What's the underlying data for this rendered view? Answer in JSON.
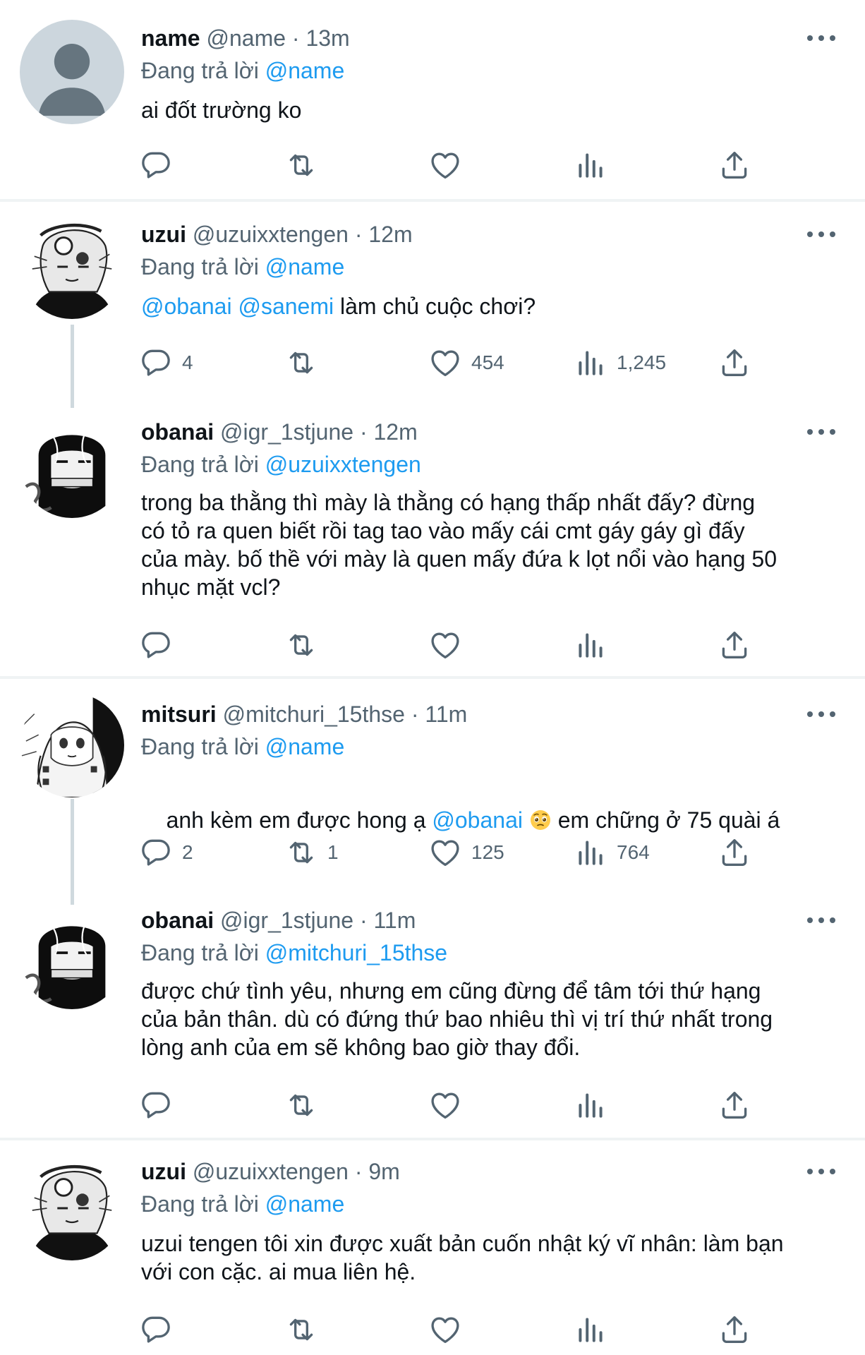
{
  "reply_label": "Đang trả lời",
  "tweets": [
    {
      "name": "name",
      "handle": "@name",
      "sep": "·",
      "time": "13m",
      "replying_to": "@name",
      "body_parts": [
        "ai đốt trường ko"
      ],
      "counts": {
        "reply": "",
        "retweet": "",
        "like": "",
        "views": ""
      }
    },
    {
      "name": "uzui",
      "handle": "@uzuixxtengen",
      "sep": "·",
      "time": "12m",
      "replying_to": "@name",
      "mentions": [
        "@obanai",
        "@sanemi"
      ],
      "text_after": " làm chủ cuộc chơi?",
      "counts": {
        "reply": "4",
        "retweet": "",
        "like": "454",
        "views": "1,245"
      }
    },
    {
      "name": "obanai",
      "handle": "@igr_1stjune",
      "sep": "·",
      "time": "12m",
      "replying_to": "@uzuixxtengen",
      "lines": [
        "trong ba thằng thì mày là thằng có hạng thấp nhất đấy? đừng",
        "có tỏ ra quen biết rồi tag tao vào mấy cái cmt gáy gáy gì đấy",
        "của mày. bố thề với mày là quen mấy đứa k lọt nổi vào hạng 50",
        "nhục mặt vcl?"
      ],
      "counts": {
        "reply": "",
        "retweet": "",
        "like": "",
        "views": ""
      }
    },
    {
      "name": "mitsuri",
      "handle": "@mitchuri_15thse",
      "sep": "·",
      "time": "11m",
      "replying_to": "@name",
      "text_before": "anh kèm em được hong ạ ",
      "mention": "@obanai",
      "text_after": " em chững ở 75 quài á",
      "emoji": "pleading-face-emoji",
      "counts": {
        "reply": "2",
        "retweet": "1",
        "like": "125",
        "views": "764"
      }
    },
    {
      "name": "obanai",
      "handle": "@igr_1stjune",
      "sep": "·",
      "time": "11m",
      "replying_to": "@mitchuri_15thse",
      "lines": [
        "được chứ tình yêu, nhưng em cũng đừng để tâm tới thứ hạng",
        "của bản thân. dù có đứng thứ bao nhiêu thì vị trí thứ nhất trong",
        "lòng anh của em sẽ không bao giờ thay đổi."
      ],
      "counts": {
        "reply": "",
        "retweet": "",
        "like": "",
        "views": ""
      }
    },
    {
      "name": "uzui",
      "handle": "@uzuixxtengen",
      "sep": "·",
      "time": "9m",
      "replying_to": "@name",
      "lines": [
        "uzui tengen tôi xin được xuất bản cuốn nhật ký vĩ nhân: làm bạn",
        "với con cặc. ai mua liên hệ."
      ],
      "counts": {
        "reply": "",
        "retweet": "",
        "like": "",
        "views": ""
      }
    }
  ],
  "icons": [
    "reply-icon",
    "retweet-icon",
    "like-icon",
    "views-icon",
    "share-icon",
    "more-icon"
  ],
  "colors": {
    "link": "#1d9bf0",
    "secondary": "#536471",
    "text": "#0f1419",
    "divider": "#eff3f4"
  }
}
